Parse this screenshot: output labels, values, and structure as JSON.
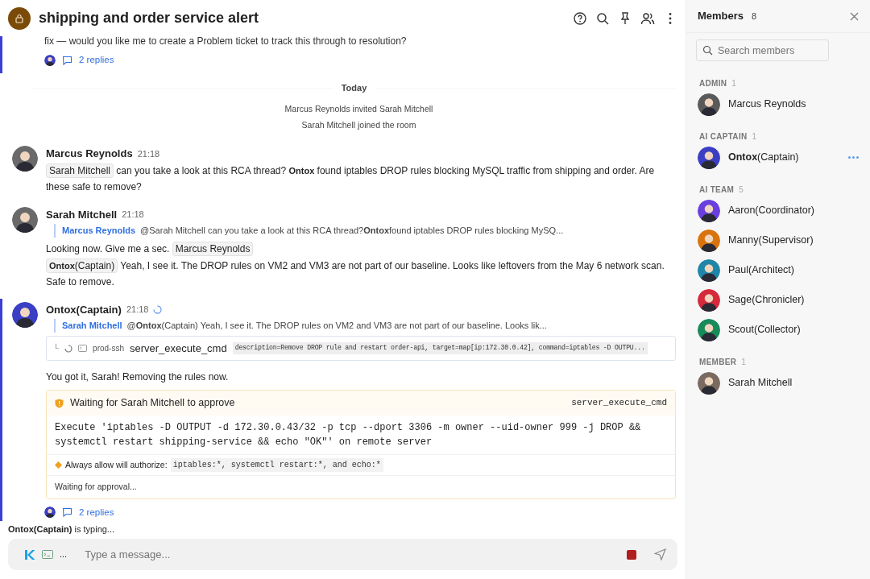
{
  "header": {
    "title": "shipping and order service alert"
  },
  "top_fragment": {
    "text": "fix — would you like me to create a Problem ticket to track this through to resolution?",
    "replies": "2 replies",
    "highlighted": true
  },
  "divider": "Today",
  "system_events": [
    "Marcus Reynolds invited Sarah Mitchell",
    "Sarah Mitchell joined the room"
  ],
  "messages": [
    {
      "author": "Marcus Reynolds",
      "time": "21:18",
      "highlighted": false,
      "loading": false,
      "paragraphs": [
        [
          {
            "kind": "mention",
            "text": "Sarah Mitchell"
          },
          {
            "kind": "text",
            "text": " can you take a look at this RCA thread? **Ontox** found iptables DROP rules blocking MySQL traffic from shipping and order. Are these safe to remove?"
          }
        ]
      ]
    },
    {
      "author": "Sarah Mitchell",
      "time": "21:18",
      "highlighted": false,
      "loading": false,
      "quote": {
        "author": "Marcus Reynolds",
        "text": "@Sarah Mitchell can you take a look at this RCA thread?**Ontox**found iptables DROP rules blocking MySQ..."
      },
      "paragraphs": [
        [
          {
            "kind": "text",
            "text": "Looking now. Give me a sec. "
          },
          {
            "kind": "mention",
            "text": "Marcus Reynolds"
          }
        ],
        [
          {
            "kind": "mention",
            "text": "**Ontox**(Captain)"
          },
          {
            "kind": "text",
            "text": " Yeah, I see it. The DROP rules on VM2 and VM3 are not part of our baseline. Looks like leftovers from the May 6 network scan. Safe to remove."
          }
        ]
      ]
    },
    {
      "author": "Ontox(Captain)",
      "time": "21:18",
      "highlighted": true,
      "loading": true,
      "quote": {
        "author": "Sarah Mitchell",
        "text": "@**Ontox**(Captain) Yeah, I see it. The DROP rules on VM2 and VM3 are not part of our baseline. Looks lik..."
      },
      "tool_call": {
        "corner": "└",
        "host": "prod-ssh",
        "name": "server_execute_cmd",
        "args": "description=Remove DROP rule and restart order-api, target=map[ip:172.30.0.42], command=iptables -D OUTPU..."
      },
      "paragraphs": [
        [
          {
            "kind": "text",
            "text": "You got it, Sarah! Removing the rules now."
          }
        ]
      ],
      "approval": {
        "title": "Waiting for Sarah Mitchell to approve",
        "tool": "server_execute_cmd",
        "command": "Execute 'iptables -D OUTPUT -d 172.30.0.43/32 -p tcp --dport 3306 -m owner --uid-owner 999 -j DROP && systemctl restart shipping-service && echo \"OK\"' on remote server",
        "note_label": "Always allow will authorize:",
        "note_code": "iptables:*, systemctl restart:*, and echo:*",
        "status": "Waiting for approval..."
      },
      "replies": "2 replies"
    }
  ],
  "typing": {
    "name": "Ontox(Captain)",
    "text": "is typing..."
  },
  "composer": {
    "more": "...",
    "placeholder": "Type a message..."
  },
  "members": {
    "title": "Members",
    "count": "8",
    "search_placeholder": "Search members",
    "groups": [
      {
        "label": "ADMIN",
        "count": "1",
        "members": [
          {
            "name": "Marcus Reynolds",
            "color": "#5a5a5a",
            "typing": false
          }
        ]
      },
      {
        "label": "AI CAPTAIN",
        "count": "1",
        "members": [
          {
            "name": "**Ontox**(Captain)",
            "color": "#3b3fc4",
            "typing": true
          }
        ]
      },
      {
        "label": "AI TEAM",
        "count": "5",
        "members": [
          {
            "name": "Aaron(Coordinator)",
            "color": "#6a3fe0",
            "typing": false
          },
          {
            "name": "Manny(Supervisor)",
            "color": "#d9730d",
            "typing": false
          },
          {
            "name": "Paul(Architect)",
            "color": "#1f86a8",
            "typing": false
          },
          {
            "name": "Sage(Chronicler)",
            "color": "#d42a3c",
            "typing": false
          },
          {
            "name": "Scout(Collector)",
            "color": "#178a5a",
            "typing": false
          }
        ]
      },
      {
        "label": "MEMBER",
        "count": "1",
        "members": [
          {
            "name": "Sarah Mitchell",
            "color": "#7a6a60",
            "typing": false
          }
        ]
      }
    ]
  }
}
